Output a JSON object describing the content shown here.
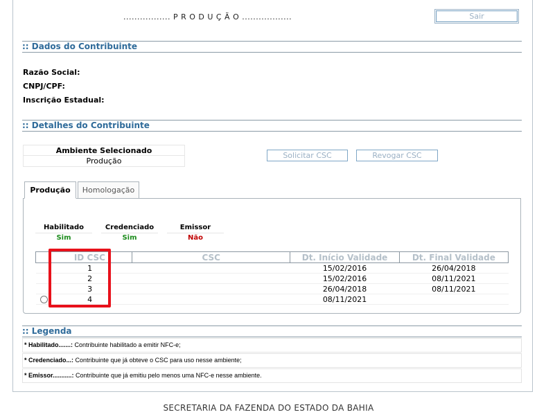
{
  "header": {
    "title": "................. P R O D U Ç Ã O ..................",
    "exit_label": "Sair"
  },
  "sections": {
    "dados": ":: Dados do Contribuinte",
    "detalhes": ":: Detalhes do Contribuinte",
    "legenda": ":: Legenda"
  },
  "contribuinte": {
    "razao_social": "Razão Social:",
    "cnpj": "CNPJ/CPF:",
    "inscricao": "Inscrição Estadual:"
  },
  "ambiente": {
    "header": "Ambiente Selecionado",
    "value": "Produção"
  },
  "actions": {
    "solicitar": "Solicitar CSC",
    "revogar": "Revogar CSC"
  },
  "tabs": [
    "Produção",
    "Homologação"
  ],
  "flags": [
    {
      "label": "Habilitado",
      "value": "Sim",
      "color": "#1a8a1a"
    },
    {
      "label": "Credenciado",
      "value": "Sim",
      "color": "#1a8a1a"
    },
    {
      "label": "Emissor",
      "value": "Não",
      "color": "#c00000"
    }
  ],
  "csc_table": {
    "headers": [
      "ID CSC",
      "CSC",
      "Dt. Início Validade",
      "Dt. Final Validade"
    ],
    "rows": [
      {
        "id": "1",
        "csc": "",
        "inicio": "15/02/2016",
        "final": "26/04/2018",
        "radio": false
      },
      {
        "id": "2",
        "csc": "",
        "inicio": "15/02/2016",
        "final": "08/11/2021",
        "radio": false
      },
      {
        "id": "3",
        "csc": "",
        "inicio": "26/04/2018",
        "final": "08/11/2021",
        "radio": false
      },
      {
        "id": "4",
        "csc": "",
        "inicio": "08/11/2021",
        "final": "",
        "radio": true
      }
    ]
  },
  "legend": [
    {
      "term": "* Habilitado.......:",
      "text": " Contribuinte habilitado a emitir NFC-e;"
    },
    {
      "term": "* Credenciado...:",
      "text": " Contribuinte que já obteve o CSC para uso nesse ambiente;"
    },
    {
      "term": "* Emissor...........:",
      "text": " Contribuinte que já emitiu pelo menos uma NFC-e nesse ambiente."
    }
  ],
  "footer": "SECRETARIA DA FAZENDA DO ESTADO DA BAHIA",
  "colors": {
    "highlight": "#e8111b",
    "section_title": "#2f6b9a"
  }
}
